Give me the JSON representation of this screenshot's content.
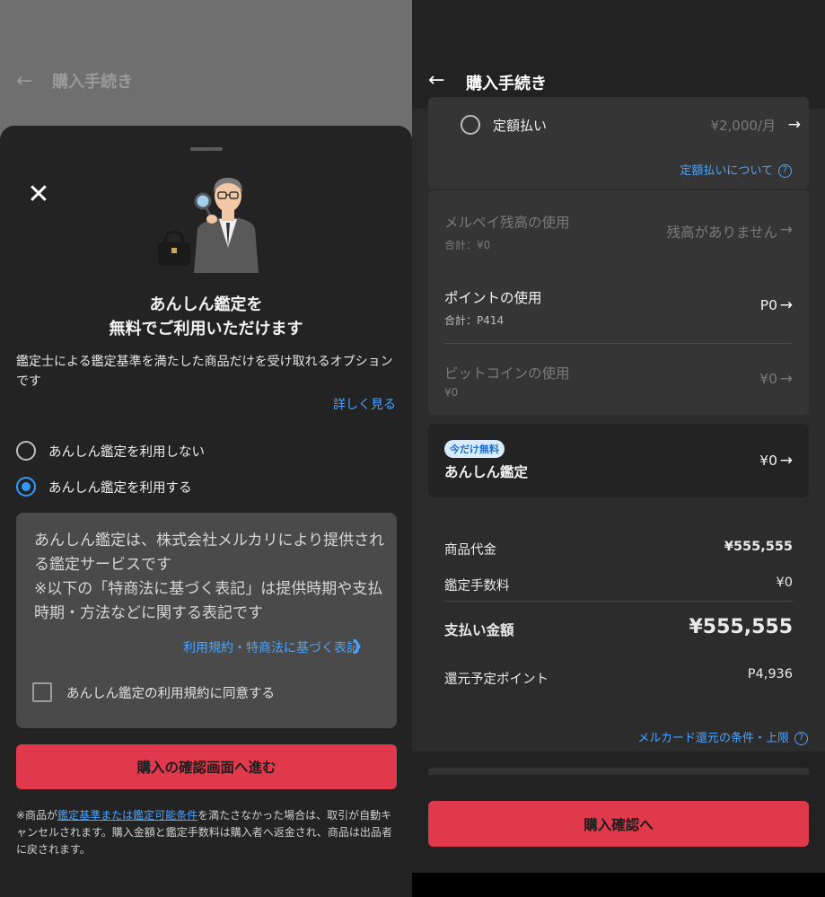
{
  "left": {
    "header": {
      "back_icon": "arrow-left-icon",
      "title": "購入手続き"
    },
    "sheet": {
      "close_icon": "close-icon",
      "illustration": "appraiser-with-magnifier-and-bag",
      "heading_line1": "あんしん鑑定を",
      "heading_line2": "無料でご利用いただけます",
      "description": "鑑定士による鑑定基準を満たした商品だけを受け取れるオプションです",
      "more_link": "詳しく見る",
      "options": [
        {
          "label": "あんしん鑑定を利用しない",
          "selected": false
        },
        {
          "label": "あんしん鑑定を利用する",
          "selected": true
        }
      ],
      "info_text": "あんしん鑑定は、株式会社メルカリにより提供される鑑定サービスです\n※以下の「特商法に基づく表記」は提供時期や支払時期・方法などに関する表記です",
      "terms_link": "利用規約・特商法に基づく表記",
      "agree_label": "あんしん鑑定の利用規約に同意する",
      "agree_checked": false,
      "cta": "購入の確認画面へ進む",
      "note_prefix": "※商品が",
      "note_link": "鑑定基準または鑑定可能条件",
      "note_suffix": "を満たさなかった場合は、取引が自動キャンセルされます。購入金額と鑑定手数料は購入者へ返金され、商品は出品者に戻されます。"
    }
  },
  "right": {
    "header": {
      "back_icon": "arrow-left-icon",
      "title": "購入手続き"
    },
    "teigaku": {
      "label": "定額払い",
      "price": "¥2,000/月",
      "link": "定額払いについて"
    },
    "merpay": {
      "label": "メルペイ残高の使用",
      "sub": "合計：¥0",
      "value": "残高がありません"
    },
    "points": {
      "label": "ポイントの使用",
      "sub": "合計：P414",
      "value": "P0"
    },
    "bitcoin": {
      "label": "ビットコインの使用",
      "sub": "¥0",
      "value": "¥0"
    },
    "anshin": {
      "badge": "今だけ無料",
      "label": "あんしん鑑定",
      "value": "¥0"
    },
    "summary": {
      "item_price_label": "商品代金",
      "item_price": "¥555,555",
      "fee_label": "鑑定手数料",
      "fee": "¥0",
      "total_label": "支払い金額",
      "total": "¥555,555",
      "points_label": "還元予定ポイント",
      "points": "P4,936"
    },
    "mercard_link": "メルカード還元の条件・上限",
    "cta": "購入確認へ"
  },
  "colors": {
    "accent": "#e0394b",
    "link": "#4aa3ff",
    "badge_bg": "#d8ecff"
  }
}
